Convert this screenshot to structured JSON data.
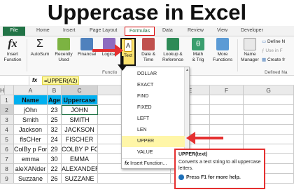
{
  "title": "Uppercase in Excel",
  "tabs": [
    "File",
    "Home",
    "Insert",
    "Page Layout",
    "Formulas",
    "Data",
    "Review",
    "View",
    "Developer"
  ],
  "ribbon": {
    "insert_function": "Insert\nFunction",
    "autosum": "AutoSum",
    "recently_used": "Recently\nUsed",
    "financial": "Financial",
    "logical": "Logical",
    "text": "Text",
    "date_time": "Date &\nTime",
    "lookup_reference": "Lookup &\nReference",
    "math_trig": "Math\n& Trig",
    "more_functions": "More\nFunctions",
    "name_manager": "Name\nManager",
    "define_name": "Define N",
    "use_in_formula": "Use in F",
    "create_from": "Create fr",
    "function_library_label": "Functio",
    "defined_names_label": "Defined Na"
  },
  "formula_bar": {
    "fx": "fx",
    "value": "=UPPER(A2)"
  },
  "columns": [
    "A",
    "B",
    "C",
    "D",
    "E",
    "F",
    "G",
    "H"
  ],
  "rows": [
    "1",
    "2",
    "3",
    "4",
    "5",
    "6",
    "7",
    "8",
    "9"
  ],
  "table": [
    [
      "Name",
      "Age",
      "Uppercase"
    ],
    [
      "jOhn",
      "23",
      "JOHN"
    ],
    [
      "Smith",
      "25",
      "SMITH"
    ],
    [
      "Jackson",
      "32",
      "JACKSON"
    ],
    [
      "flsCHer",
      "24",
      "FISCHER"
    ],
    [
      "ColBy p Ford",
      "29",
      "COLBY P FORD"
    ],
    [
      "emma",
      "30",
      "EMMA"
    ],
    [
      "aleXANder",
      "22",
      "ALEXANDER"
    ],
    [
      "Suzzane",
      "26",
      "SUZZANE"
    ]
  ],
  "dropdown": {
    "items": [
      "DOLLAR",
      "EXACT",
      "FIND",
      "FIXED",
      "LEFT",
      "LEN",
      "UPPER",
      "VALUE"
    ],
    "insert_function": "Insert Function..."
  },
  "tooltip": {
    "title": "UPPER(text)",
    "desc": "Converts a text string to all uppercase letters.",
    "help": "Press F1 for more help."
  },
  "colors": {
    "excel_green": "#217346",
    "header_blue": "#00b0f0",
    "highlight_red": "#e53030",
    "text_button": "#fce36f"
  }
}
